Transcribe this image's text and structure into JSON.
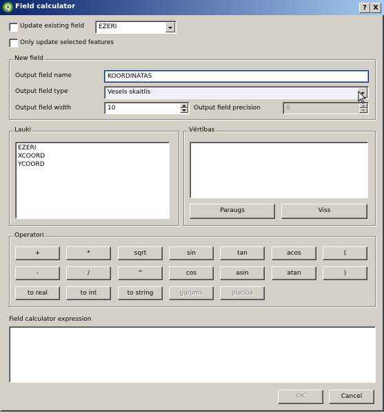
{
  "window": {
    "title": "Field calculator",
    "help_glyph": "?",
    "close_glyph": "X"
  },
  "top": {
    "update_existing_label": "Update existing field",
    "update_existing_checked": false,
    "existing_field_value": "EZERI",
    "only_selected_label": "Only update selected features",
    "only_selected_checked": false
  },
  "new_field": {
    "title": "New field",
    "name_label": "Output field name",
    "name_value": "KOORDINATAS",
    "type_label": "Output field type",
    "type_value": "Vesels skaitlis",
    "width_label": "Output field width",
    "width_value": "10",
    "precision_label": "Output field precision",
    "precision_value": "0"
  },
  "lauki": {
    "title": "Lauki",
    "items": [
      "EZERI",
      "XCOORD",
      "YCOORD"
    ]
  },
  "vertibas": {
    "title": "Vērtības",
    "sample_button": "Paraugs",
    "all_button": "Viss"
  },
  "operators": {
    "title": "Operatori",
    "row1": [
      "+",
      "*",
      "sqrt",
      "sin",
      "tan",
      "acos",
      "("
    ],
    "row2": [
      "-",
      "/",
      "^",
      "cos",
      "asin",
      "atan",
      ")"
    ],
    "row3": [
      "to real",
      "to int",
      "to string",
      "garums",
      "platība"
    ]
  },
  "expression": {
    "label": "Field calculator expression",
    "value": ""
  },
  "footer": {
    "ok_label": "OK",
    "cancel_label": "Cancel"
  },
  "colors": {
    "title_start": "#0a246a",
    "title_end": "#a6caf0",
    "face": "#d4d0c8"
  }
}
